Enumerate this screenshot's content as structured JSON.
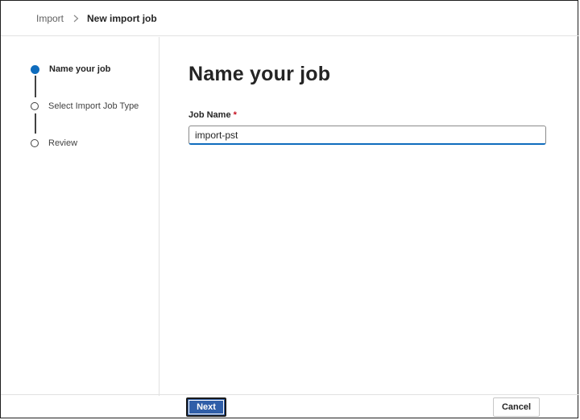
{
  "breadcrumb": {
    "parent": "Import",
    "current": "New import job"
  },
  "stepper": {
    "steps": [
      {
        "label": "Name your job",
        "active": true
      },
      {
        "label": "Select Import Job Type",
        "active": false
      },
      {
        "label": "Review",
        "active": false
      }
    ]
  },
  "main": {
    "title": "Name your job",
    "job_name_label": "Job Name",
    "required_marker": "*",
    "job_name_value": "import-pst"
  },
  "footer": {
    "next_label": "Next",
    "cancel_label": "Cancel"
  },
  "colors": {
    "accent": "#0f6cbd",
    "primary_button": "#2f5ea8",
    "required": "#c50f1f"
  },
  "icons": {
    "breadcrumb_separator": "chevron-right-icon"
  }
}
